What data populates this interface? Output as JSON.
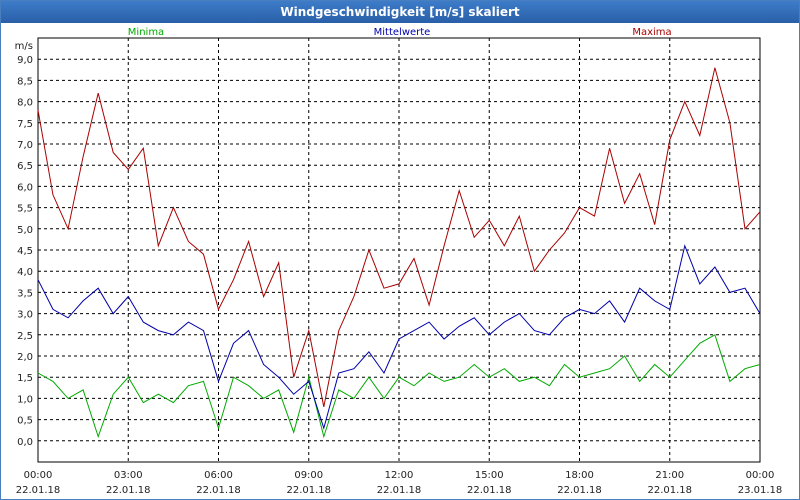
{
  "window_title": "Windgeschwindigkeit [m/s] skaliert",
  "chart_data": {
    "type": "line",
    "title": "Windgeschwindigkeit [m/s] skaliert",
    "ylabel": "m/s",
    "ylim": [
      -0.5,
      9.5
    ],
    "y_ticks": [
      "0,0",
      "0,5",
      "1,0",
      "1,5",
      "2,0",
      "2,5",
      "3,0",
      "3,5",
      "4,0",
      "4,5",
      "5,0",
      "5,5",
      "6,0",
      "6,5",
      "7,0",
      "7,5",
      "8,0",
      "8,5",
      "9,0"
    ],
    "x_ticks": [
      {
        "time": "00:00",
        "date": "22.01.18"
      },
      {
        "time": "03:00",
        "date": "22.01.18"
      },
      {
        "time": "06:00",
        "date": "22.01.18"
      },
      {
        "time": "09:00",
        "date": "22.01.18"
      },
      {
        "time": "12:00",
        "date": "22.01.18"
      },
      {
        "time": "15:00",
        "date": "22.01.18"
      },
      {
        "time": "18:00",
        "date": "22.01.18"
      },
      {
        "time": "21:00",
        "date": "22.01.18"
      },
      {
        "time": "00:00",
        "date": "23.01.18"
      }
    ],
    "x_hours": [
      0,
      24
    ],
    "grid": true,
    "legend_position": "top",
    "series": [
      {
        "name": "Minima",
        "color": "#00aa00",
        "x_hours": [
          0,
          0.5,
          1,
          1.5,
          2,
          2.5,
          3,
          3.5,
          4,
          4.5,
          5,
          5.5,
          6,
          6.5,
          7,
          7.5,
          8,
          8.5,
          9,
          9.5,
          10,
          10.5,
          11,
          11.5,
          12,
          12.5,
          13,
          13.5,
          14,
          14.5,
          15,
          15.5,
          16,
          16.5,
          17,
          17.5,
          18,
          18.5,
          19,
          19.5,
          20,
          20.5,
          21,
          21.5,
          22,
          22.5,
          23,
          23.5,
          24
        ],
        "values": [
          1.6,
          1.4,
          1.0,
          1.2,
          0.1,
          1.1,
          1.5,
          0.9,
          1.1,
          0.9,
          1.3,
          1.4,
          0.3,
          1.5,
          1.3,
          1.0,
          1.2,
          0.2,
          1.5,
          0.1,
          1.2,
          1.0,
          1.5,
          1.0,
          1.5,
          1.3,
          1.6,
          1.4,
          1.5,
          1.8,
          1.5,
          1.7,
          1.4,
          1.5,
          1.3,
          1.8,
          1.5,
          1.6,
          1.7,
          2.0,
          1.4,
          1.8,
          1.5,
          1.9,
          2.3,
          2.5,
          1.4,
          1.7,
          1.8
        ]
      },
      {
        "name": "Mittelwerte",
        "color": "#0000aa",
        "x_hours": [
          0,
          0.5,
          1,
          1.5,
          2,
          2.5,
          3,
          3.5,
          4,
          4.5,
          5,
          5.5,
          6,
          6.5,
          7,
          7.5,
          8,
          8.5,
          9,
          9.5,
          10,
          10.5,
          11,
          11.5,
          12,
          12.5,
          13,
          13.5,
          14,
          14.5,
          15,
          15.5,
          16,
          16.5,
          17,
          17.5,
          18,
          18.5,
          19,
          19.5,
          20,
          20.5,
          21,
          21.5,
          22,
          22.5,
          23,
          23.5,
          24
        ],
        "values": [
          3.8,
          3.1,
          2.9,
          3.3,
          3.6,
          3.0,
          3.4,
          2.8,
          2.6,
          2.5,
          2.8,
          2.6,
          1.4,
          2.3,
          2.6,
          1.8,
          1.5,
          1.1,
          1.4,
          0.3,
          1.6,
          1.7,
          2.1,
          1.6,
          2.4,
          2.6,
          2.8,
          2.4,
          2.7,
          2.9,
          2.5,
          2.8,
          3.0,
          2.6,
          2.5,
          2.9,
          3.1,
          3.0,
          3.3,
          2.8,
          3.6,
          3.3,
          3.1,
          4.6,
          3.7,
          4.1,
          3.5,
          3.6,
          3.0
        ]
      },
      {
        "name": "Maxima",
        "color": "#aa0000",
        "x_hours": [
          0,
          0.5,
          1,
          1.5,
          2,
          2.5,
          3,
          3.5,
          4,
          4.5,
          5,
          5.5,
          6,
          6.5,
          7,
          7.5,
          8,
          8.5,
          9,
          9.5,
          10,
          10.5,
          11,
          11.5,
          12,
          12.5,
          13,
          13.5,
          14,
          14.5,
          15,
          15.5,
          16,
          16.5,
          17,
          17.5,
          18,
          18.5,
          19,
          19.5,
          20,
          20.5,
          21,
          21.5,
          22,
          22.5,
          23,
          23.5,
          24
        ],
        "values": [
          7.8,
          5.8,
          5.0,
          6.7,
          8.2,
          6.8,
          6.4,
          6.9,
          4.6,
          5.5,
          4.7,
          4.4,
          3.1,
          3.8,
          4.7,
          3.4,
          4.2,
          1.5,
          2.6,
          0.8,
          2.6,
          3.4,
          4.5,
          3.6,
          3.7,
          4.3,
          3.2,
          4.6,
          5.9,
          4.8,
          5.2,
          4.6,
          5.3,
          4.0,
          4.5,
          4.9,
          5.5,
          5.3,
          6.9,
          5.6,
          6.3,
          5.1,
          7.1,
          8.0,
          7.2,
          8.8,
          7.5,
          5.0,
          5.4
        ]
      }
    ]
  }
}
